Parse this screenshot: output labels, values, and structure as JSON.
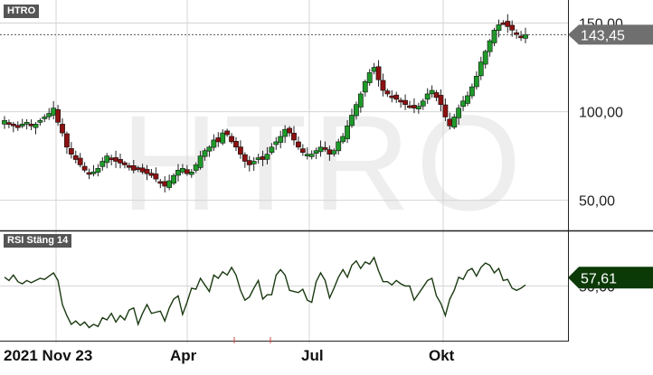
{
  "colors": {
    "up": "#1f9a2a",
    "down": "#8c1111",
    "wick": "#222222",
    "rsi_line": "#1b3a12",
    "rsi_badge": "#0b3a06",
    "price_badge": "#6f6f6f",
    "grid": "#d4d4d4",
    "watermark": "#eeeeee"
  },
  "chart_data": [
    {
      "type": "candlestick",
      "title": "HTRO",
      "watermark": "HTRO",
      "current_value": 143.45,
      "current_value_label": "143,45",
      "ylim": [
        33,
        163
      ],
      "y_ticks": [
        50,
        100,
        150
      ],
      "y_tick_labels": [
        "50,00",
        "100,00",
        "150,00"
      ],
      "x_tick_labels": [
        "2021 Nov 23",
        "Apr",
        "Jul",
        "Okt"
      ],
      "x_tick_positions": [
        0.2,
        0.44,
        0.63,
        0.86
      ],
      "close_series": [
        95,
        93,
        92,
        91,
        93,
        94,
        92,
        93,
        95,
        97,
        99,
        102,
        94,
        88,
        80,
        76,
        73,
        70,
        67,
        65,
        66,
        68,
        72,
        75,
        73,
        72,
        71,
        70,
        69,
        67,
        68,
        66,
        65,
        64,
        62,
        60,
        58,
        61,
        64,
        67,
        68,
        65,
        66,
        70,
        75,
        78,
        80,
        84,
        83,
        88,
        87,
        83,
        80,
        76,
        72,
        70,
        72,
        74,
        73,
        76,
        80,
        83,
        86,
        90,
        88,
        84,
        80,
        77,
        76,
        76,
        78,
        80,
        79,
        76,
        78,
        83,
        86,
        92,
        98,
        104,
        110,
        117,
        122,
        125,
        118,
        112,
        110,
        108,
        107,
        106,
        104,
        103,
        102,
        103,
        106,
        110,
        112,
        108,
        104,
        97,
        92,
        97,
        102,
        106,
        109,
        114,
        120,
        128,
        134,
        140,
        146,
        149,
        150,
        148,
        146,
        144,
        142,
        143.45
      ]
    },
    {
      "type": "line",
      "title": "RSI Stäng 14",
      "current_value": 57.61,
      "current_value_label": "57,61",
      "y_ticks": [
        50
      ],
      "y_tick_labels": [
        "50,00"
      ],
      "ylim": [
        0,
        100
      ],
      "values": [
        58,
        55,
        60,
        54,
        52,
        55,
        53,
        55,
        57,
        56,
        59,
        62,
        55,
        33,
        23,
        15,
        18,
        14,
        17,
        12,
        15,
        13,
        21,
        19,
        25,
        17,
        23,
        19,
        28,
        30,
        15,
        25,
        33,
        25,
        26,
        27,
        18,
        30,
        38,
        41,
        24,
        35,
        48,
        47,
        57,
        51,
        45,
        60,
        57,
        63,
        60,
        67,
        60,
        46,
        37,
        40,
        48,
        55,
        38,
        42,
        42,
        60,
        65,
        60,
        46,
        45,
        44,
        47,
        37,
        35,
        54,
        62,
        55,
        39,
        48,
        58,
        65,
        58,
        69,
        73,
        66,
        72,
        70,
        76,
        64,
        54,
        54,
        51,
        55,
        52,
        50,
        50,
        37,
        43,
        49,
        55,
        57,
        41,
        34,
        23,
        38,
        46,
        58,
        56,
        64,
        66,
        59,
        67,
        71,
        69,
        62,
        66,
        55,
        56,
        48,
        46,
        48,
        51
      ]
    }
  ]
}
